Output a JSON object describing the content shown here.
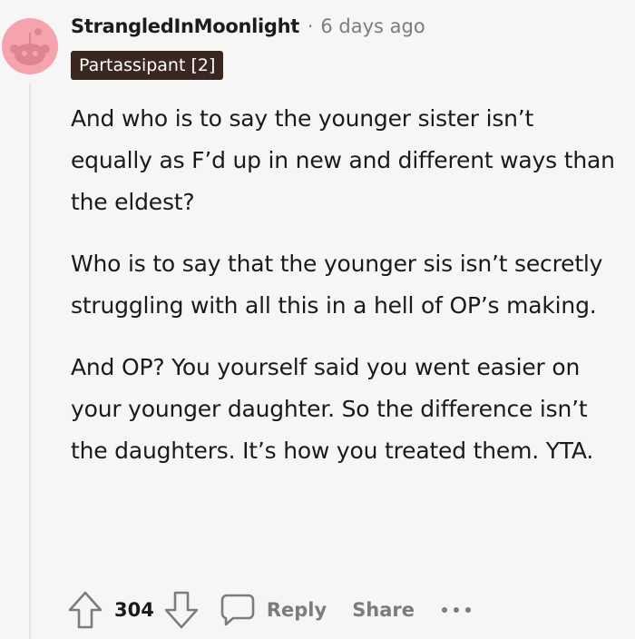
{
  "comment": {
    "author": "StrangledInMoonlight",
    "separator": "·",
    "timestamp": "6 days ago",
    "flair": "Partassipant [2]",
    "paragraphs": [
      "And who is to say the younger sister isn’t equally as F’d up in new and different ways than the eldest?",
      "Who is to say that the younger sis isn’t secretly struggling with all this in a hell of OP’s making.",
      "And OP? You yourself said you went easier on your younger daughter. So the difference isn’t the daughters. It’s how you treated them. YTA."
    ]
  },
  "actions": {
    "score": "304",
    "reply_label": "Reply",
    "share_label": "Share",
    "icons": {
      "upvote": "upvote-arrow-icon",
      "downvote": "downvote-arrow-icon",
      "reply": "speech-bubble-icon",
      "more": "more-dots-icon"
    }
  },
  "colors": {
    "background": "#f6f6f6",
    "avatar": "#f5a3ad",
    "flair_bg": "#3a2720",
    "muted": "#7c7c7c",
    "text": "#1a1a1b"
  }
}
